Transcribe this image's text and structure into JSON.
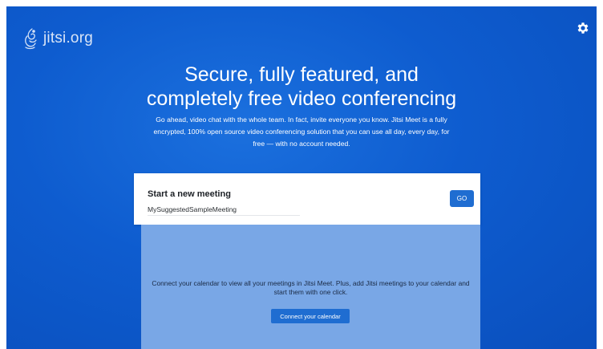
{
  "header": {
    "logo_text": "jitsi.org",
    "settings_icon": "gear-icon",
    "logo_icon": "jitsi-logo-icon"
  },
  "hero": {
    "title_line1": "Secure, fully featured, and",
    "title_line2": "completely free video conferencing",
    "description": "Go ahead, video chat with the whole team. In fact, invite everyone you know. Jitsi Meet is a fully encrypted, 100% open source video conferencing solution that you can use all day, every day, for free — with no account needed."
  },
  "meeting": {
    "label": "Start a new meeting",
    "room_value": "MySuggestedSampleMeeting",
    "go_label": "GO"
  },
  "calendar": {
    "text": "Connect your calendar to view all your meetings in Jitsi Meet. Plus, add Jitsi meetings to your calendar and start them with one click.",
    "button_label": "Connect your calendar"
  },
  "colors": {
    "background": "#0e5ccf",
    "button": "#1f6dd1",
    "panel": "#79a7e6"
  }
}
